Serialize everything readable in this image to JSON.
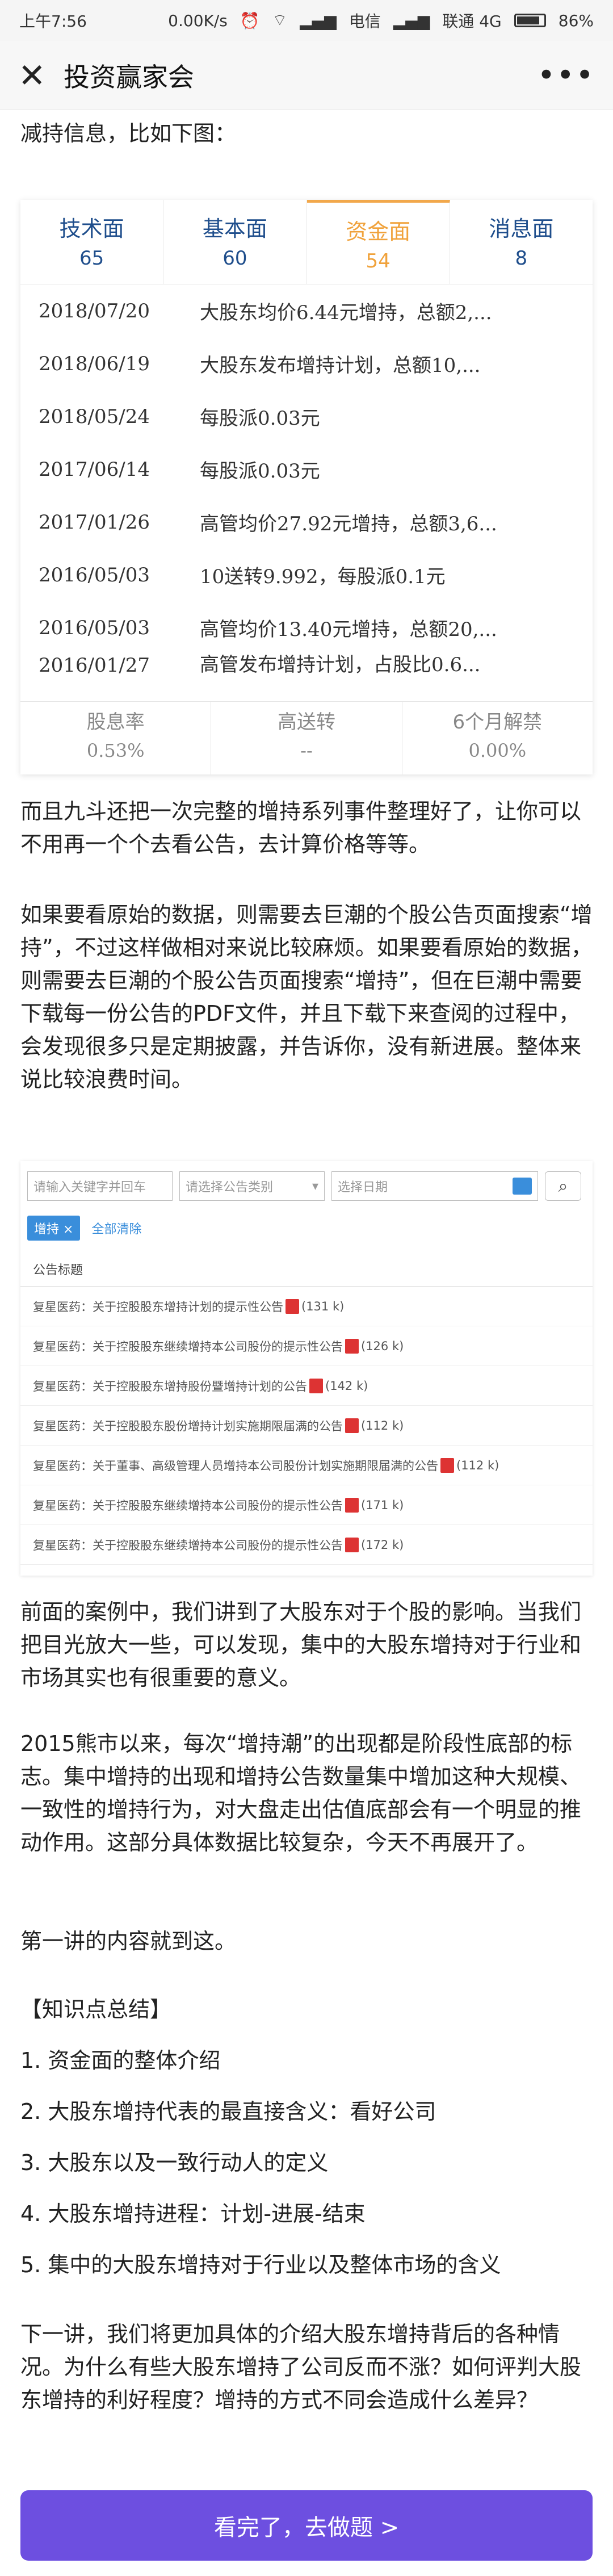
{
  "status_bar": {
    "time": "上午7:56",
    "speed": "0.00K/s",
    "carrier1": "电信",
    "carrier2": "联通 4G",
    "battery": "86%"
  },
  "nav": {
    "title": "投资赢家会",
    "close_icon": "close-icon",
    "more_icon": "more-icon"
  },
  "article": {
    "intro_line": "减持信息，比如下图：",
    "p1": "而且九斗还把一次完整的增持系列事件整理好了，让你可以不用再一个个去看公告，去计算价格等等。",
    "p2": "如果要看原始的数据，则需要去巨潮的个股公告页面搜索“增持”，不过这样做相对来说比较麻烦。如果要看原始的数据，则需要去巨潮的个股公告页面搜索“增持”，但在巨潮中需要下载每一份公告的PDF文件，并且下载下来查阅的过程中，会发现很多只是定期披露，并告诉你，没有新进展。整体来说比较浪费时间。",
    "p3": "前面的案例中，我们讲到了大股东对于个股的影响。当我们把目光放大一些，可以发现，集中的大股东增持对于行业和市场其实也有很重要的意义。",
    "p4": "2015熊市以来，每次“增持潮”的出现都是阶段性底部的标志。集中增持的出现和增持公告数量集中增加这种大规模、一致性的增持行为，对大盘走出估值底部会有一个明显的推动作用。这部分具体数据比较复杂，今天不再展开了。",
    "p5": "第一讲的内容就到这。",
    "p6": "【知识点总结】",
    "s1": "1. 资金面的整体介绍",
    "s2": "2. 大股东增持代表的最直接含义：看好公司",
    "s3": "3. 大股东以及一致行动人的定义",
    "s4": "4. 大股东增持进程：计划-进展-结束",
    "s5": "5. 集中的大股东增持对于行业以及整体市场的含义",
    "p7": "下一讲，我们将更加具体的介绍大股东增持背后的各种情况。为什么有些大股东增持了公司反而不涨？如何评判大股东增持的利好程度？增持的方式不同会造成什么差异？"
  },
  "stock_card": {
    "tabs": [
      {
        "label": "技术面",
        "count": "65"
      },
      {
        "label": "基本面",
        "count": "60"
      },
      {
        "label": "资金面",
        "count": "54"
      },
      {
        "label": "消息面",
        "count": "8"
      }
    ],
    "rows": [
      {
        "date": "2018/07/20",
        "desc": "大股东均价6.44元增持，总额2,..."
      },
      {
        "date": "2018/06/19",
        "desc": "大股东发布增持计划，总额10,..."
      },
      {
        "date": "2018/05/24",
        "desc": "每股派0.03元"
      },
      {
        "date": "2017/06/14",
        "desc": "每股派0.03元"
      },
      {
        "date": "2017/01/26",
        "desc": "高管均价27.92元增持，总额3,6..."
      },
      {
        "date": "2016/05/03",
        "desc": "10送转9.992，每股派0.1元"
      },
      {
        "date": "2016/05/03",
        "desc": "高管均价13.40元增持，总额20,..."
      },
      {
        "date": "2016/01/27",
        "desc": "高管发布增持计划，占股比0.6..."
      }
    ],
    "stats": [
      {
        "label": "股息率",
        "value": "0.53%"
      },
      {
        "label": "高送转",
        "value": "--"
      },
      {
        "label": "6个月解禁",
        "value": "0.00%"
      }
    ]
  },
  "announce_shot": {
    "keyword_placeholder": "请输入关键字并回车",
    "category_placeholder": "请选择公告类别",
    "date_placeholder": "选择日期",
    "tag": "增持 ×",
    "clear": "全部清除",
    "header": "公告标题",
    "rows": [
      {
        "title": "复星医药：关于控股股东增持计划的提示性公告",
        "size": "(131 k)"
      },
      {
        "title": "复星医药：关于控股股东继续增持本公司股份的提示性公告",
        "size": "(126 k)"
      },
      {
        "title": "复星医药：关于控股股东增持股份暨增持计划的公告",
        "size": "(142 k)"
      },
      {
        "title": "复星医药：关于控股股东股份增持计划实施期限届满的公告",
        "size": "(112 k)"
      },
      {
        "title": "复星医药：关于董事、高级管理人员增持本公司股份计划实施期限届满的公告",
        "size": "(112 k)"
      },
      {
        "title": "复星医药：关于控股股东继续增持本公司股份的提示性公告",
        "size": "(171 k)"
      },
      {
        "title": "复星医药：关于控股股东继续增持本公司股份的提示性公告",
        "size": "(172 k)"
      }
    ]
  },
  "cta": {
    "label": "看完了，去做题 >"
  }
}
